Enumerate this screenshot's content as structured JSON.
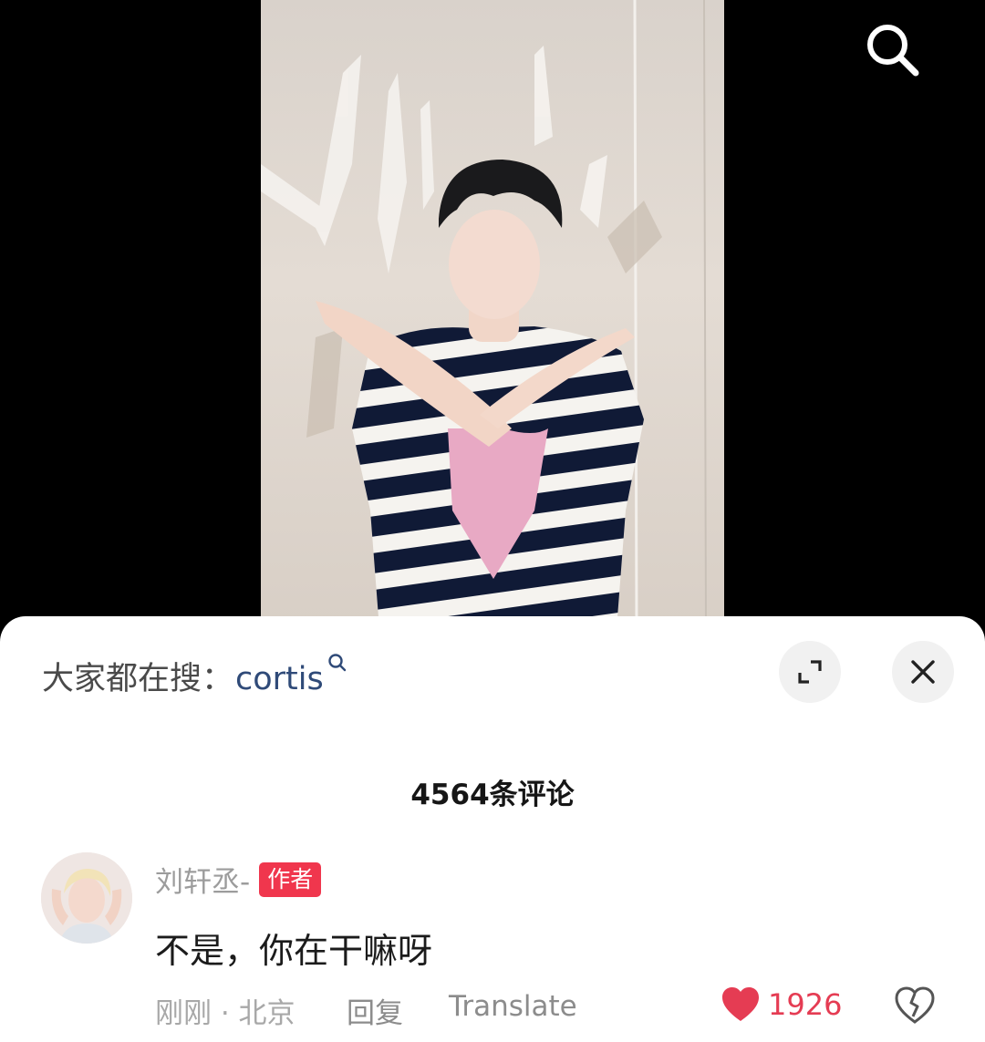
{
  "top_bar": {
    "search_icon": "search-icon"
  },
  "trending": {
    "prefix": "大家都在搜：",
    "term": "cortis",
    "term_color": "#2f4a78"
  },
  "sheet_controls": {
    "expand_icon": "expand-icon",
    "close_icon": "close-icon"
  },
  "comments_header": {
    "count_label": "4564条评论"
  },
  "comment": {
    "author": "刘轩丞-",
    "author_badge": "作者",
    "badge_color": "#f0364d",
    "text": "不是，你在干嘛呀",
    "time_location": "刚刚 · 北京",
    "reply_label": "回复",
    "translate_label": "Translate",
    "like_count": "1926",
    "like_color": "#e53c53",
    "liked": true
  }
}
